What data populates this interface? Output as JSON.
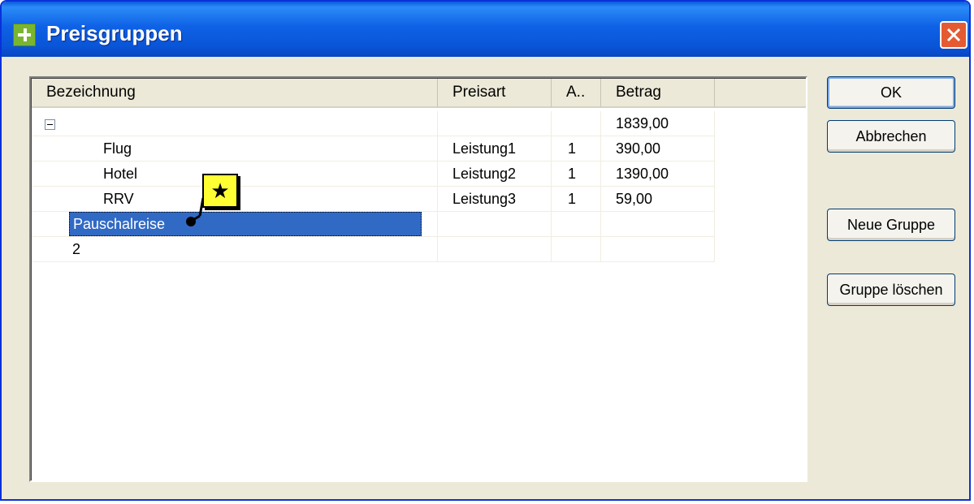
{
  "window": {
    "title": "Preisgruppen",
    "icon": "plus-icon",
    "close": "close-icon"
  },
  "columns": [
    "Bezeichnung",
    "Preisart",
    "A..",
    "Betrag"
  ],
  "rows": [
    {
      "bezeichnung": "",
      "preisart": "",
      "anzahl": "",
      "betrag": "1839,00",
      "expander": "minus"
    },
    {
      "bezeichnung": "Flug",
      "preisart": "Leistung1",
      "anzahl": "1",
      "betrag": "390,00"
    },
    {
      "bezeichnung": "Hotel",
      "preisart": "Leistung2",
      "anzahl": "1",
      "betrag": "1390,00"
    },
    {
      "bezeichnung": "RRV",
      "preisart": "Leistung3",
      "anzahl": "1",
      "betrag": "59,00"
    },
    {
      "bezeichnung": "Pauschalreise",
      "preisart": "",
      "anzahl": "",
      "betrag": "",
      "selected": true
    },
    {
      "bezeichnung": "2",
      "preisart": "",
      "anzahl": "",
      "betrag": ""
    }
  ],
  "buttons": {
    "ok": "OK",
    "cancel": "Abbrechen",
    "new_group": "Neue Gruppe",
    "delete_group": "Gruppe löschen"
  },
  "callout": {
    "symbol": "★",
    "color": "#ffff33"
  },
  "colors": {
    "titlebar": "#0a55d8",
    "selection": "#316ac5",
    "dialog_bg": "#ece9d8"
  }
}
